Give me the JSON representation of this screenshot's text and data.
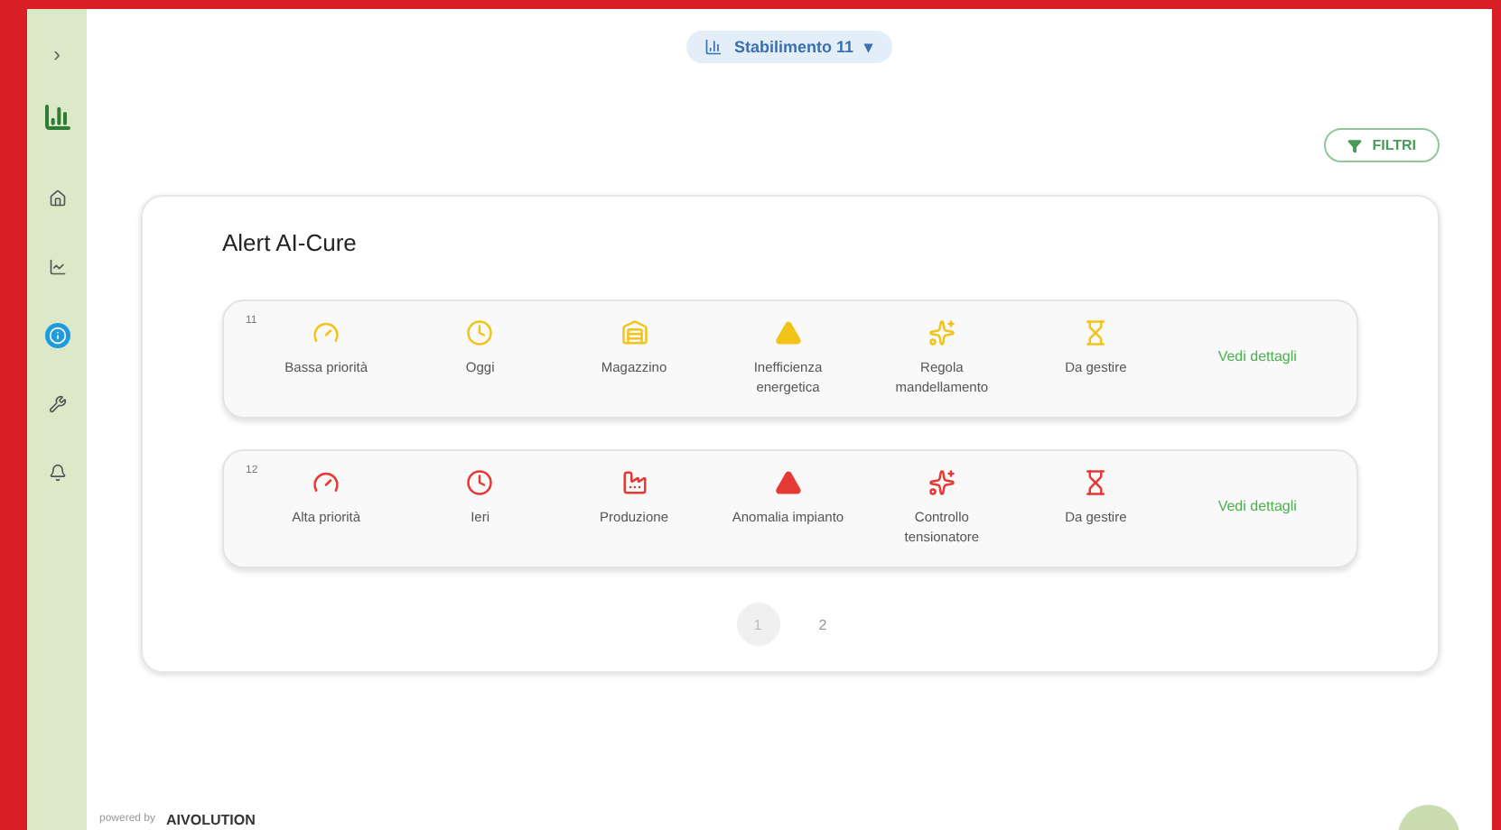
{
  "sidebar": {
    "toggle": "›",
    "items": [
      {
        "selected": false
      },
      {
        "selected": false
      },
      {
        "selected": true
      },
      {
        "selected": false
      },
      {
        "selected": false
      }
    ]
  },
  "plant_selector": {
    "label": "Stabilimento 11",
    "caret": "▾"
  },
  "filter_button": {
    "label": "FILTRI"
  },
  "card": {
    "title": "Alert AI-Cure",
    "alerts": [
      {
        "number": "11",
        "color": "#f2c318",
        "fields": [
          "Bassa priorità",
          "Oggi",
          "Magazzino",
          "Inefficienza energetica",
          "Regola mandellamento",
          "Da gestire"
        ],
        "link": "Vedi dettagli"
      },
      {
        "number": "12",
        "color": "#e53935",
        "fields": [
          "Alta priorità",
          "Ieri",
          "Produzione",
          "Anomalia impianto",
          "Controllo tensionatore",
          "Da gestire"
        ],
        "link": "Vedi dettagli"
      }
    ],
    "pagination": [
      {
        "label": "1",
        "selected": true
      },
      {
        "label": "2",
        "selected": false
      }
    ]
  },
  "footer": {
    "powered_by": "powered by",
    "brand": "AIVOLUTION"
  }
}
